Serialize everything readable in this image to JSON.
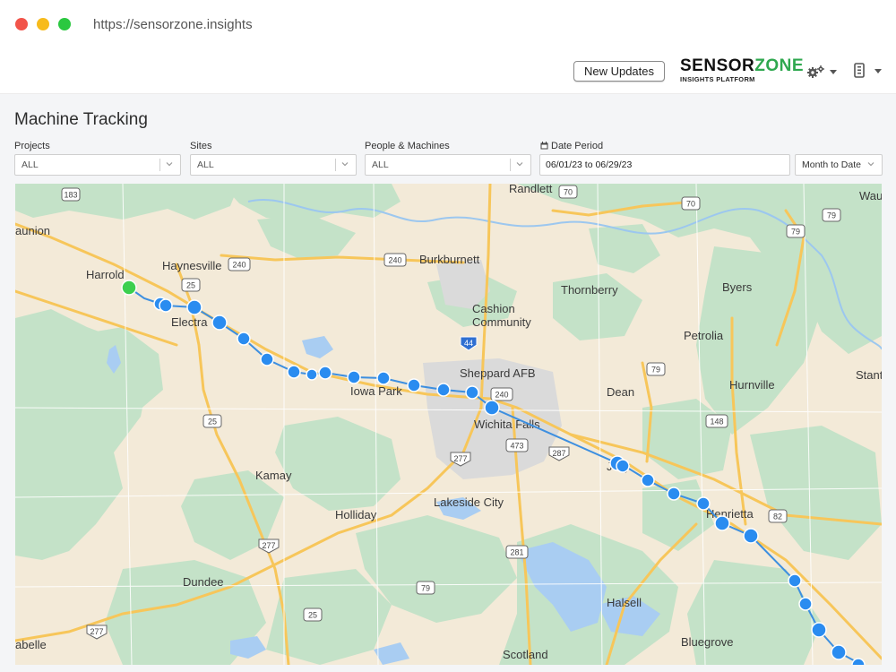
{
  "browser": {
    "url": "https://sensorzone.insights"
  },
  "header": {
    "new_updates_label": "New Updates",
    "logo": {
      "main_a": "SENSOR",
      "main_b": "ZONE",
      "sub": "INSIGHTS PLATFORM"
    },
    "icons": [
      "gears-icon",
      "device-icon"
    ]
  },
  "page": {
    "title": "Machine Tracking"
  },
  "filters": {
    "projects": {
      "label": "Projects",
      "value": "ALL"
    },
    "sites": {
      "label": "Sites",
      "value": "ALL"
    },
    "people": {
      "label": "People & Machines",
      "value": "ALL"
    },
    "date_period": {
      "label": "Date Period",
      "value": "06/01/23 to 06/29/23",
      "preset": "Month to Date"
    }
  },
  "map": {
    "places": [
      "Randlett",
      "Waurika",
      "aunion",
      "Harrold",
      "Haynesville",
      "Burkburnett",
      "Thornberry",
      "Byers",
      "Electra",
      "Cashion Community",
      "Petrolia",
      "Iowa Park",
      "Sheppard AFB",
      "Dean",
      "Hurnville",
      "Stanton",
      "Wichita Falls",
      "Jolly",
      "Kamay",
      "Lakeside City",
      "Henrietta",
      "Holliday",
      "Dundee",
      "Halsell",
      "abelle",
      "Bluegrove",
      "Scotland"
    ],
    "route_points": 28,
    "start_point_color": "#3ccf4e",
    "point_color": "#2a8cf0",
    "route_color": "#3d8fe0"
  }
}
